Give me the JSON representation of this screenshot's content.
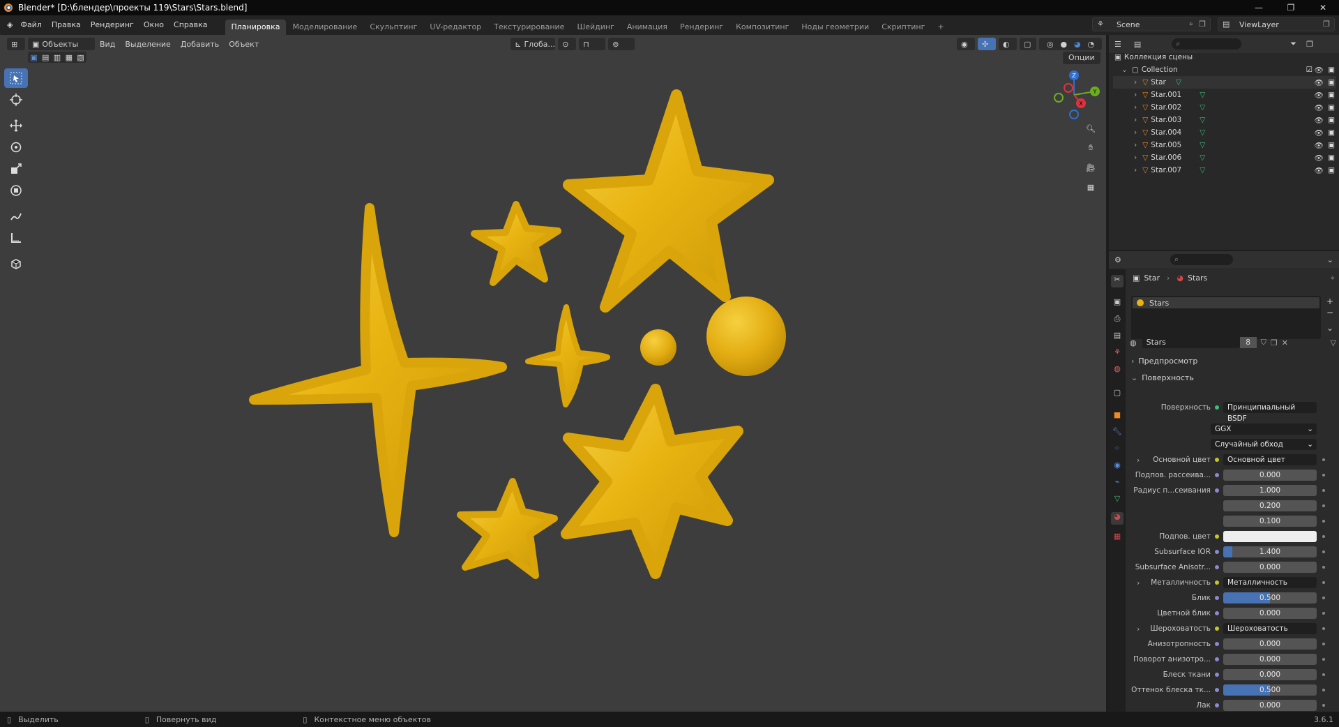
{
  "window": {
    "title": "Blender* [D:\\блендер\\проекты 119\\Stars\\Stars.blend]",
    "controls": [
      "—",
      "❐",
      "✕"
    ]
  },
  "menus": [
    "Файл",
    "Правка",
    "Рендеринг",
    "Окно",
    "Справка"
  ],
  "workspaces": [
    {
      "label": "Планировка",
      "active": true
    },
    {
      "label": "Моделирование"
    },
    {
      "label": "Скульптинг"
    },
    {
      "label": "UV-редактор"
    },
    {
      "label": "Текстурирование"
    },
    {
      "label": "Шейдинг"
    },
    {
      "label": "Анимация"
    },
    {
      "label": "Рендеринг"
    },
    {
      "label": "Композитинг"
    },
    {
      "label": "Ноды геометрии"
    },
    {
      "label": "Скриптинг"
    },
    {
      "label": "+"
    }
  ],
  "scene": {
    "name": "Scene",
    "view_layer": "ViewLayer"
  },
  "viewport_header": {
    "mode": "Объекты",
    "menus": [
      "Вид",
      "Выделение",
      "Добавить",
      "Объект"
    ],
    "orientation": "Глоба...",
    "options": "Опции"
  },
  "outliner": {
    "root": "Коллекция сцены",
    "collection": "Collection",
    "objects": [
      "Star",
      "Star.001",
      "Star.002",
      "Star.003",
      "Star.004",
      "Star.005",
      "Star.006",
      "Star.007"
    ]
  },
  "properties": {
    "breadcrumb": [
      "Star",
      "Stars"
    ],
    "material_slot": "Stars",
    "material_name": "Stars",
    "users": "8",
    "panels": {
      "preview": "Предпросмотр",
      "surface": "Поверхность"
    },
    "surface_label": "Поверхность",
    "surface_value": "Принципиальный BSDF",
    "distribution": "GGX",
    "subsurface_method": "Случайный обход",
    "rows": [
      {
        "label": "Основной цвет",
        "value": "Основной цвет",
        "type": "link"
      },
      {
        "label": "Подпов. рассеива...",
        "value": "0.000",
        "type": "num",
        "fill": 0
      },
      {
        "label": "Радиус п...сеивания",
        "value": "1.000",
        "type": "num",
        "fill": 0
      },
      {
        "label": "",
        "value": "0.200",
        "type": "num",
        "fill": 0
      },
      {
        "label": "",
        "value": "0.100",
        "type": "num",
        "fill": 0
      },
      {
        "label": "Подпов. цвет",
        "value": "",
        "type": "color"
      },
      {
        "label": "Subsurface IOR",
        "value": "1.400",
        "type": "num",
        "fill": 0.1
      },
      {
        "label": "Subsurface Anisotr...",
        "value": "0.000",
        "type": "num",
        "fill": 0
      },
      {
        "label": "Металличность",
        "value": "Металличность",
        "type": "link"
      },
      {
        "label": "Блик",
        "value": "0.500",
        "type": "num",
        "fill": 0.5
      },
      {
        "label": "Цветной блик",
        "value": "0.000",
        "type": "num",
        "fill": 0
      },
      {
        "label": "Шероховатость",
        "value": "Шероховатость",
        "type": "link"
      },
      {
        "label": "Анизотропность",
        "value": "0.000",
        "type": "num",
        "fill": 0
      },
      {
        "label": "Поворот анизотро...",
        "value": "0.000",
        "type": "num",
        "fill": 0
      },
      {
        "label": "Блеск ткани",
        "value": "0.000",
        "type": "num",
        "fill": 0
      },
      {
        "label": "Оттенок блеска тк...",
        "value": "0.500",
        "type": "num",
        "fill": 0.5
      },
      {
        "label": "Лак",
        "value": "0.000",
        "type": "num",
        "fill": 0
      }
    ]
  },
  "statusbar": {
    "select": "Выделить",
    "rotate": "Повернуть вид",
    "context": "Контекстное меню объектов",
    "version": "3.6.1"
  },
  "colors": {
    "star": "#e8b411",
    "accent": "#4772b3",
    "viewport": "#3d3d3d"
  }
}
